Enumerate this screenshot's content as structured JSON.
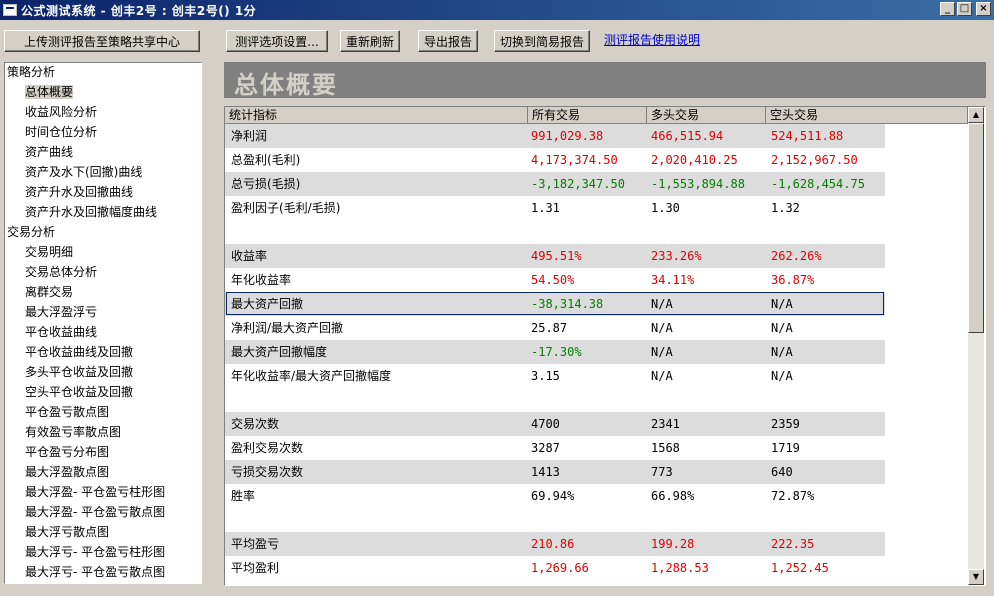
{
  "window": {
    "title": "公式测试系统 - 创丰2号 : 创丰2号() 1分"
  },
  "toolbar": {
    "upload": "上传测评报告至策略共享中心",
    "options": "测评选项设置...",
    "refresh": "重新刷新",
    "export": "导出报告",
    "simple": "切换到简易报告",
    "help": "测评报告使用说明"
  },
  "tree": {
    "groups": [
      {
        "label": "策略分析",
        "items": [
          "总体概要",
          "收益风险分析",
          "时间仓位分析",
          "资产曲线",
          "资产及水下(回撤)曲线",
          "资产升水及回撤曲线",
          "资产升水及回撤幅度曲线"
        ]
      },
      {
        "label": "交易分析",
        "items": [
          "交易明细",
          "交易总体分析",
          "离群交易",
          "最大浮盈浮亏",
          "平仓收益曲线",
          "平仓收益曲线及回撤",
          "多头平仓收益及回撤",
          "空头平仓收益及回撤",
          "平仓盈亏散点图",
          "有效盈亏率散点图",
          "平仓盈亏分布图",
          "最大浮盈散点图",
          "最大浮盈- 平仓盈亏柱形图",
          "最大浮盈- 平仓盈亏散点图",
          "最大浮亏散点图",
          "最大浮亏- 平仓盈亏柱形图",
          "最大浮亏- 平仓盈亏散点图"
        ]
      }
    ],
    "selected": "总体概要"
  },
  "section_title": "总体概要",
  "table": {
    "headers": [
      "统计指标",
      "所有交易",
      "多头交易",
      "空头交易"
    ],
    "rows": [
      {
        "label": "净利润",
        "values": [
          "991,029.38",
          "466,515.94",
          "524,511.88"
        ],
        "color": "red",
        "shade": true
      },
      {
        "label": "总盈利(毛利)",
        "values": [
          "4,173,374.50",
          "2,020,410.25",
          "2,152,967.50"
        ],
        "color": "red",
        "shade": false
      },
      {
        "label": "总亏损(毛损)",
        "values": [
          "-3,182,347.50",
          "-1,553,894.88",
          "-1,628,454.75"
        ],
        "color": "green",
        "shade": true
      },
      {
        "label": "盈利因子(毛利/毛损)",
        "values": [
          "1.31",
          "1.30",
          "1.32"
        ],
        "color": "black",
        "shade": false
      },
      {
        "blank": true
      },
      {
        "label": "收益率",
        "values": [
          "495.51%",
          "233.26%",
          "262.26%"
        ],
        "color": "red",
        "shade": true
      },
      {
        "label": "年化收益率",
        "values": [
          "54.50%",
          "34.11%",
          "36.87%"
        ],
        "color": "red",
        "shade": false
      },
      {
        "label": "最大资产回撤",
        "values": [
          "-38,314.38",
          "N/A",
          "N/A"
        ],
        "color": "green",
        "color_rest": "black",
        "shade": true,
        "focused": true
      },
      {
        "label": "净利润/最大资产回撤",
        "values": [
          "25.87",
          "N/A",
          "N/A"
        ],
        "color": "black",
        "shade": false
      },
      {
        "label": "最大资产回撤幅度",
        "values": [
          "-17.30%",
          "N/A",
          "N/A"
        ],
        "color": "green",
        "color_rest": "black",
        "shade": true
      },
      {
        "label": "年化收益率/最大资产回撤幅度",
        "values": [
          "3.15",
          "N/A",
          "N/A"
        ],
        "color": "black",
        "shade": false
      },
      {
        "blank": true
      },
      {
        "label": "交易次数",
        "values": [
          "4700",
          "2341",
          "2359"
        ],
        "color": "black",
        "shade": true
      },
      {
        "label": "盈利交易次数",
        "values": [
          "3287",
          "1568",
          "1719"
        ],
        "color": "black",
        "shade": false
      },
      {
        "label": "亏损交易次数",
        "values": [
          "1413",
          "773",
          "640"
        ],
        "color": "black",
        "shade": true
      },
      {
        "label": "胜率",
        "values": [
          "69.94%",
          "66.98%",
          "72.87%"
        ],
        "color": "black",
        "shade": false
      },
      {
        "blank": true
      },
      {
        "label": "平均盈亏",
        "values": [
          "210.86",
          "199.28",
          "222.35"
        ],
        "color": "red",
        "shade": true
      },
      {
        "label": "平均盈利",
        "values": [
          "1,269.66",
          "1,288.53",
          "1,252.45"
        ],
        "color": "red",
        "shade": false
      }
    ]
  }
}
